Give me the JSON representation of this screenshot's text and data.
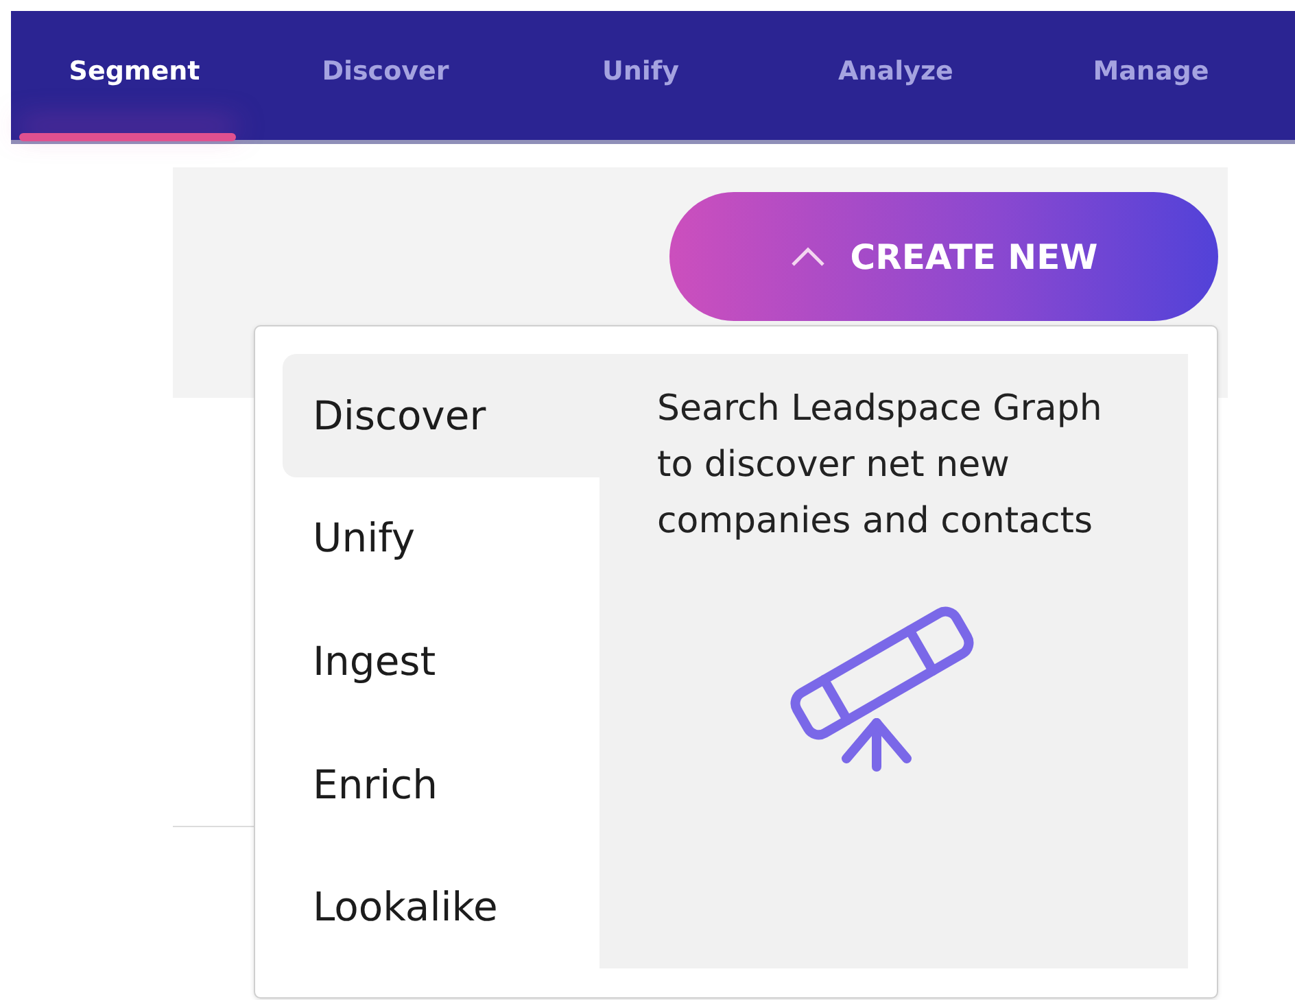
{
  "nav": {
    "tabs": [
      {
        "label": "Segment",
        "selected": true
      },
      {
        "label": "Discover",
        "selected": false
      },
      {
        "label": "Unify",
        "selected": false
      },
      {
        "label": "Analyze",
        "selected": false
      },
      {
        "label": "Manage",
        "selected": false
      }
    ]
  },
  "create_button": {
    "label": "CREATE NEW",
    "expanded": true
  },
  "create_menu": {
    "items": [
      {
        "label": "Discover",
        "selected": true
      },
      {
        "label": "Unify",
        "selected": false
      },
      {
        "label": "Ingest",
        "selected": false
      },
      {
        "label": "Enrich",
        "selected": false
      },
      {
        "label": "Lookalike",
        "selected": false
      }
    ],
    "description": "Search Leadspace Graph to discover net new companies and contacts"
  }
}
